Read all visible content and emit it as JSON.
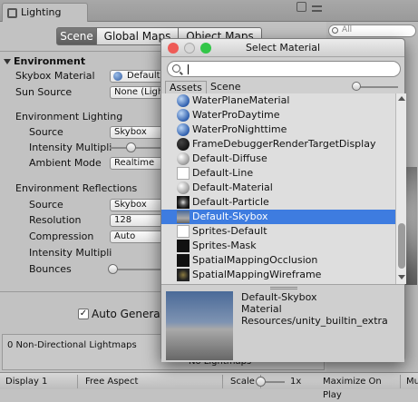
{
  "window": {
    "tab_title": "Lighting",
    "search_placeholder": "All"
  },
  "mode_tabs": [
    "Scene",
    "Global Maps",
    "Object Maps"
  ],
  "environment": {
    "header": "Environment",
    "skybox_label": "Skybox Material",
    "skybox_value": "Default-",
    "sun_label": "Sun Source",
    "sun_value": "None (Ligh",
    "lighting_header": "Environment Lighting",
    "source_label": "Source",
    "source_value": "Skybox",
    "intensity_label": "Intensity Multipli",
    "ambient_label": "Ambient Mode",
    "ambient_value": "Realtime",
    "reflections_header": "Environment Reflections",
    "refl_source_label": "Source",
    "refl_source_value": "Skybox",
    "resolution_label": "Resolution",
    "resolution_value": "128",
    "compression_label": "Compression",
    "compression_value": "Auto",
    "refl_intensity_label": "Intensity Multipli",
    "bounces_label": "Bounces"
  },
  "auto_generate_label": "Auto Generate",
  "auto_generate_checked": true,
  "lightmaps": {
    "left_text": "0 Non-Directional Lightmaps",
    "center_text": "No Lightmaps"
  },
  "status_bar": {
    "display": "Display 1",
    "aspect": "Free Aspect",
    "scale_label": "Scale",
    "scale_value": "1x",
    "maximize": "Maximize On Play",
    "mute": "Mu"
  },
  "dialog": {
    "title": "Select Material",
    "search_value": "",
    "tabs": [
      "Assets",
      "Scene"
    ],
    "items": [
      {
        "label": "WaterPlaneMaterial",
        "icon": "blue-sphere-icon"
      },
      {
        "label": "WaterProDaytime",
        "icon": "blue-sphere-icon"
      },
      {
        "label": "WaterProNighttime",
        "icon": "blue-sphere-icon"
      },
      {
        "label": "FrameDebuggerRenderTargetDisplay",
        "icon": "black-sphere-icon"
      },
      {
        "label": "Default-Diffuse",
        "icon": "gray-sphere-icon"
      },
      {
        "label": "Default-Line",
        "icon": "white-square-icon"
      },
      {
        "label": "Default-Material",
        "icon": "gray-sphere-icon"
      },
      {
        "label": "Default-Particle",
        "icon": "dark-sphere-icon"
      },
      {
        "label": "Default-Skybox",
        "icon": "sky-gradient-icon"
      },
      {
        "label": "Sprites-Default",
        "icon": "white-square-icon"
      },
      {
        "label": "Sprites-Mask",
        "icon": "black-square-icon"
      },
      {
        "label": "SpatialMappingOcclusion",
        "icon": "black-square-icon"
      },
      {
        "label": "SpatialMappingWireframe",
        "icon": "dark-wire-icon"
      }
    ],
    "selected_index": 8,
    "preview": {
      "name": "Default-Skybox",
      "type": "Material",
      "path": "Resources/unity_builtin_extra"
    }
  },
  "colors": {
    "selection": "#3e7ce0",
    "close_dot": "#ee5b57",
    "min_dot": "#f5bf4f",
    "zoom_dot": "#32c648"
  }
}
